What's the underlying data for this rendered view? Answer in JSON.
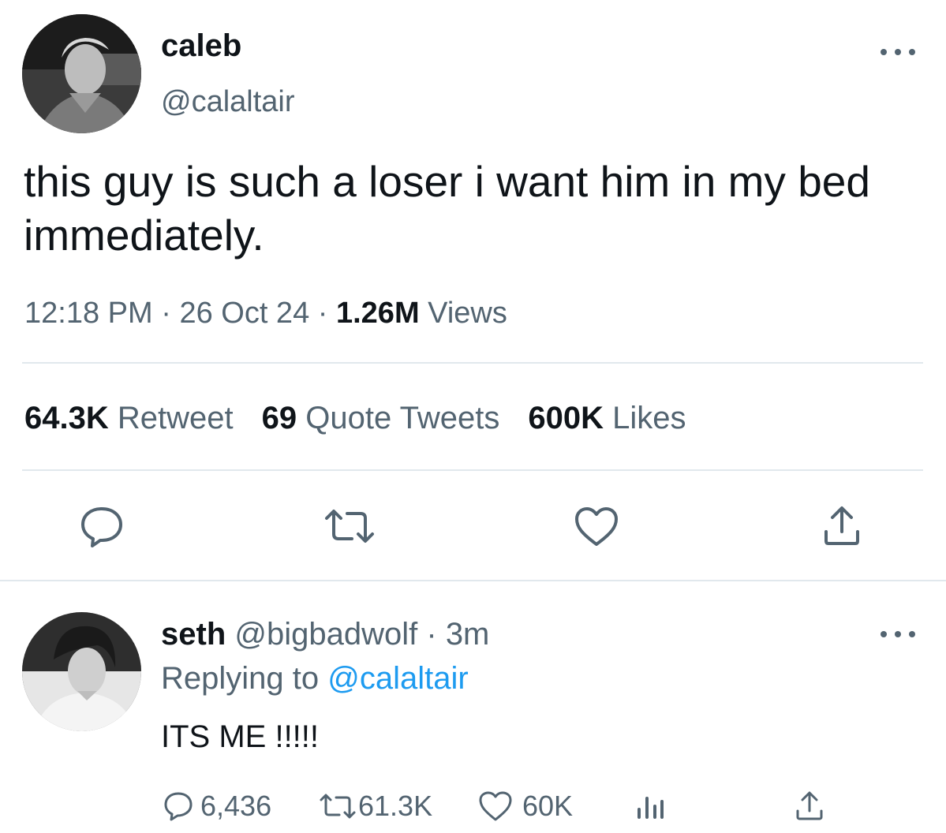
{
  "tweet": {
    "author_name": "caleb",
    "author_handle": "@calaltair",
    "text": "this guy is such a loser i want him in my bed immediately.",
    "time": "12:18 PM",
    "date": "26 Oct 24",
    "views_count": "1.26M",
    "views_label": "Views",
    "separator": "·"
  },
  "stats": {
    "retweets_count": "64.3K",
    "retweets_label": "Retweet",
    "quotes_count": "69",
    "quotes_label": "Quote Tweets",
    "likes_count": "600K",
    "likes_label": "Likes"
  },
  "actions": {
    "reply_icon": "comment-icon",
    "retweet_icon": "retweet-icon",
    "like_icon": "heart-icon",
    "share_icon": "share-icon"
  },
  "reply": {
    "author_name": "seth",
    "author_handle": "@bigbadwolf",
    "separator": "·",
    "time": "3m",
    "replying_prefix": "Replying to",
    "replying_handle": "@calaltair",
    "text": "ITS ME !!!!!",
    "replies_count": "6,436",
    "retweets_count": "61.3K",
    "likes_count": "60K"
  },
  "colors": {
    "text_primary": "#0f1419",
    "text_secondary": "#536471",
    "link": "#1d9bf0",
    "divider": "#e1e8ed"
  }
}
